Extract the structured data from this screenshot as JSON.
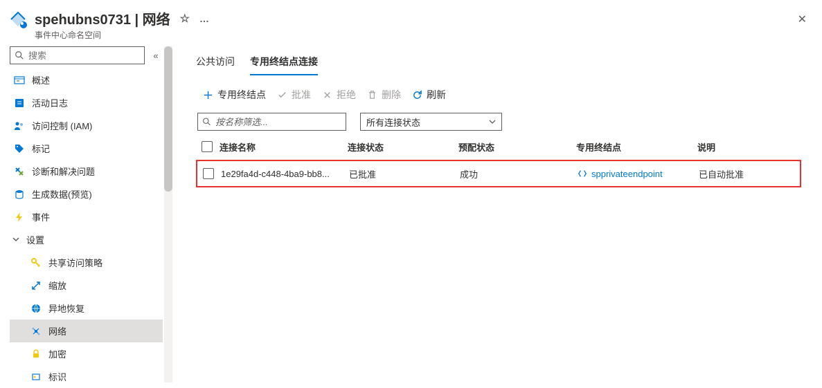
{
  "header": {
    "title": "spehubns0731 | 网络",
    "subtitle": "事件中心命名空间"
  },
  "sidebar": {
    "search_placeholder": "搜索",
    "items": {
      "overview": "概述",
      "activity": "活动日志",
      "iam": "访问控制 (IAM)",
      "tags": "标记",
      "diagnose": "诊断和解决问题",
      "gendata": "生成数据(预览)",
      "events": "事件",
      "settings_group": "设置",
      "shared_access": "共享访问策略",
      "scale": "缩放",
      "geo": "异地恢复",
      "network": "网络",
      "encrypt": "加密",
      "identity": "标识"
    }
  },
  "tabs": {
    "public": "公共访问",
    "private": "专用终结点连接"
  },
  "toolbar": {
    "add_endpoint": "专用终结点",
    "approve": "批准",
    "reject": "拒绝",
    "delete": "删除",
    "refresh": "刷新"
  },
  "filters": {
    "name_placeholder": "按名称筛选...",
    "state_dropdown": "所有连接状态"
  },
  "table": {
    "headers": {
      "name": "连接名称",
      "conn_state": "连接状态",
      "prov_state": "预配状态",
      "endpoint": "专用终结点",
      "desc": "说明"
    },
    "rows": [
      {
        "name": "1e29fa4d-c448-4ba9-bb8...",
        "conn_state": "已批准",
        "prov_state": "成功",
        "endpoint": "spprivateendpoint",
        "desc": "已自动批准"
      }
    ]
  }
}
